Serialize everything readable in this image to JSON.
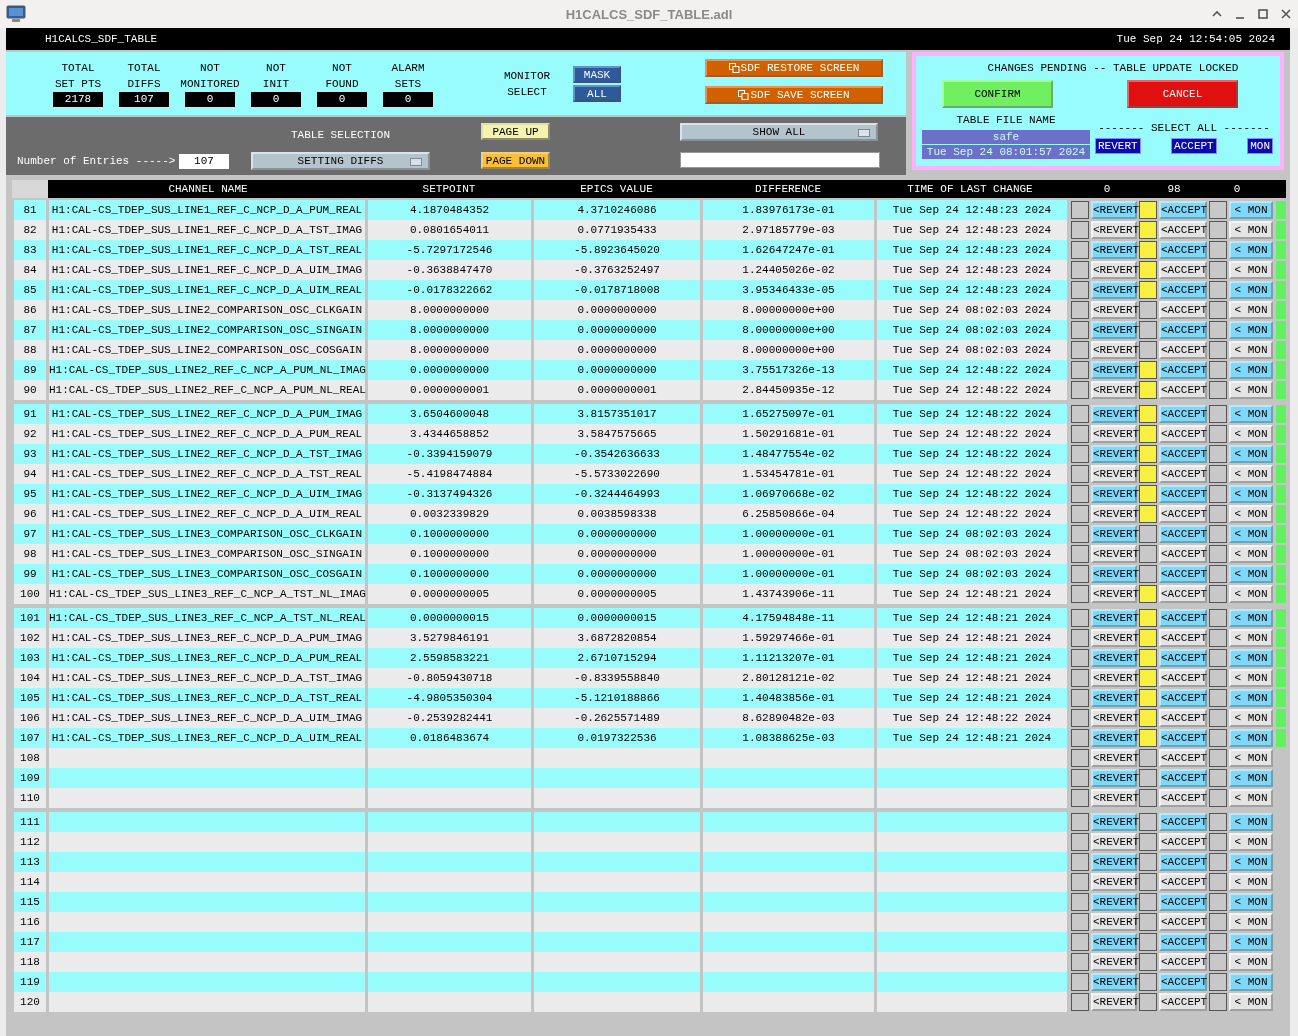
{
  "window": {
    "title": "H1CALCS_SDF_TABLE.adl"
  },
  "header": {
    "screen_name": "H1CALCS_SDF_TABLE",
    "datetime": "Tue Sep 24 12:54:05 2024"
  },
  "stats": [
    {
      "label_lines": [
        "TOTAL",
        "SET PTS"
      ],
      "value": "2178"
    },
    {
      "label_lines": [
        "TOTAL",
        "DIFFS"
      ],
      "value": "107"
    },
    {
      "label_lines": [
        "NOT",
        "MONITORED"
      ],
      "value": "0"
    },
    {
      "label_lines": [
        "NOT",
        "INIT"
      ],
      "value": "0"
    },
    {
      "label_lines": [
        "NOT",
        "FOUND"
      ],
      "value": "0"
    },
    {
      "label_lines": [
        "ALARM",
        "SETS"
      ],
      "value": "0"
    }
  ],
  "monitor_select": {
    "label_lines": [
      "MONITOR",
      "SELECT"
    ],
    "buttons": [
      "MASK",
      "ALL"
    ]
  },
  "screen_buttons": [
    "SDF RESTORE SCREEN",
    "SDF SAVE SCREEN"
  ],
  "table_selection": {
    "label": "TABLE SELECTION",
    "menu": "SETTING DIFFS",
    "entries_label": "Number of Entries ----->",
    "entries_value": "107"
  },
  "page_buttons": [
    {
      "label": "PAGE UP",
      "kind": "up"
    },
    {
      "label": "PAGE DOWN",
      "kind": "down"
    }
  ],
  "filter": {
    "menu": "SHOW ALL"
  },
  "pending_panel": {
    "message": "CHANGES PENDING -- TABLE UPDATE LOCKED",
    "confirm": "CONFIRM",
    "cancel": "CANCEL",
    "file_label": "TABLE FILE NAME",
    "file_name": "safe",
    "file_time": "Tue Sep 24 08:01:57 2024",
    "select_all_label": "------- SELECT ALL -------",
    "select_all_buttons": [
      "REVERT",
      "ACCEPT",
      "MON"
    ]
  },
  "table": {
    "columns": [
      "CHANNEL NAME",
      "SETPOINT",
      "EPICS VALUE",
      "DIFFERENCE",
      "TIME OF LAST CHANGE"
    ],
    "counts": [
      "0",
      "98",
      "0"
    ],
    "groups": [
      {
        "rows": [
          {
            "n": "81",
            "channel": "H1:CAL-CS_TDEP_SUS_LINE1_REF_C_NCP_D_A_PUM_REAL",
            "setpoint": "4.1870484352",
            "epics": "4.3710246086",
            "diff": "1.83976173e-01",
            "time": "Tue Sep 24 12:48:23 2024",
            "revert_checked": false,
            "accept_checked": true,
            "mon_checked": false,
            "status_on": true,
            "buttons": [
              "<REVERT",
              "<ACCEPT",
              "< MON"
            ]
          },
          {
            "n": "82",
            "channel": "H1:CAL-CS_TDEP_SUS_LINE1_REF_C_NCP_D_A_TST_IMAG",
            "setpoint": "0.0801654011",
            "epics": "0.0771935433",
            "diff": "2.97185779e-03",
            "time": "Tue Sep 24 12:48:23 2024",
            "revert_checked": false,
            "accept_checked": true,
            "mon_checked": false,
            "status_on": true,
            "buttons": [
              "<REVERT",
              "<ACCEPT",
              "< MON"
            ]
          },
          {
            "n": "83",
            "channel": "H1:CAL-CS_TDEP_SUS_LINE1_REF_C_NCP_D_A_TST_REAL",
            "setpoint": "-5.7297172546",
            "epics": "-5.8923645020",
            "diff": "1.62647247e-01",
            "time": "Tue Sep 24 12:48:23 2024",
            "revert_checked": false,
            "accept_checked": true,
            "mon_checked": false,
            "status_on": true,
            "buttons": [
              "<REVERT",
              "<ACCEPT",
              "< MON"
            ]
          },
          {
            "n": "84",
            "channel": "H1:CAL-CS_TDEP_SUS_LINE1_REF_C_NCP_D_A_UIM_IMAG",
            "setpoint": "-0.3638847470",
            "epics": "-0.3763252497",
            "diff": "1.24405026e-02",
            "time": "Tue Sep 24 12:48:23 2024",
            "revert_checked": false,
            "accept_checked": true,
            "mon_checked": false,
            "status_on": true,
            "buttons": [
              "<REVERT",
              "<ACCEPT",
              "< MON"
            ]
          },
          {
            "n": "85",
            "channel": "H1:CAL-CS_TDEP_SUS_LINE1_REF_C_NCP_D_A_UIM_REAL",
            "setpoint": "-0.0178322662",
            "epics": "-0.0178718008",
            "diff": "3.95346433e-05",
            "time": "Tue Sep 24 12:48:23 2024",
            "revert_checked": false,
            "accept_checked": true,
            "mon_checked": false,
            "status_on": true,
            "buttons": [
              "<REVERT",
              "<ACCEPT",
              "< MON"
            ]
          },
          {
            "n": "86",
            "channel": "H1:CAL-CS_TDEP_SUS_LINE2_COMPARISON_OSC_CLKGAIN",
            "setpoint": "8.0000000000",
            "epics": "0.0000000000",
            "diff": "8.00000000e+00",
            "time": "Tue Sep 24 08:02:03 2024",
            "revert_checked": false,
            "accept_checked": false,
            "mon_checked": false,
            "status_on": true,
            "buttons": [
              "<REVERT",
              "<ACCEPT",
              "< MON"
            ]
          },
          {
            "n": "87",
            "channel": "H1:CAL-CS_TDEP_SUS_LINE2_COMPARISON_OSC_SINGAIN",
            "setpoint": "8.0000000000",
            "epics": "0.0000000000",
            "diff": "8.00000000e+00",
            "time": "Tue Sep 24 08:02:03 2024",
            "revert_checked": false,
            "accept_checked": false,
            "mon_checked": false,
            "status_on": true,
            "buttons": [
              "<REVERT",
              "<ACCEPT",
              "< MON"
            ]
          },
          {
            "n": "88",
            "channel": "H1:CAL-CS_TDEP_SUS_LINE2_COMPARISON_OSC_COSGAIN",
            "setpoint": "8.0000000000",
            "epics": "0.0000000000",
            "diff": "8.00000000e+00",
            "time": "Tue Sep 24 08:02:03 2024",
            "revert_checked": false,
            "accept_checked": false,
            "mon_checked": false,
            "status_on": true,
            "buttons": [
              "<REVERT",
              "<ACCEPT",
              "< MON"
            ]
          },
          {
            "n": "89",
            "channel": "H1:CAL-CS_TDEP_SUS_LINE2_REF_C_NCP_A_PUM_NL_IMAG",
            "setpoint": "0.0000000000",
            "epics": "0.0000000000",
            "diff": "3.75517326e-13",
            "time": "Tue Sep 24 12:48:22 2024",
            "revert_checked": false,
            "accept_checked": true,
            "mon_checked": false,
            "status_on": true,
            "buttons": [
              "<REVERT",
              "<ACCEPT",
              "< MON"
            ]
          },
          {
            "n": "90",
            "channel": "H1:CAL-CS_TDEP_SUS_LINE2_REF_C_NCP_A_PUM_NL_REAL",
            "setpoint": "0.0000000001",
            "epics": "0.0000000001",
            "diff": "2.84450935e-12",
            "time": "Tue Sep 24 12:48:22 2024",
            "revert_checked": false,
            "accept_checked": true,
            "mon_checked": false,
            "status_on": true,
            "buttons": [
              "<REVERT",
              "<ACCEPT",
              "< MON"
            ]
          }
        ]
      },
      {
        "rows": [
          {
            "n": "91",
            "channel": "H1:CAL-CS_TDEP_SUS_LINE2_REF_C_NCP_D_A_PUM_IMAG",
            "setpoint": "3.6504600048",
            "epics": "3.8157351017",
            "diff": "1.65275097e-01",
            "time": "Tue Sep 24 12:48:22 2024",
            "revert_checked": false,
            "accept_checked": true,
            "mon_checked": false,
            "status_on": true,
            "buttons": [
              "<REVERT",
              "<ACCEPT",
              "< MON"
            ]
          },
          {
            "n": "92",
            "channel": "H1:CAL-CS_TDEP_SUS_LINE2_REF_C_NCP_D_A_PUM_REAL",
            "setpoint": "3.4344658852",
            "epics": "3.5847575665",
            "diff": "1.50291681e-01",
            "time": "Tue Sep 24 12:48:22 2024",
            "revert_checked": false,
            "accept_checked": true,
            "mon_checked": false,
            "status_on": true,
            "buttons": [
              "<REVERT",
              "<ACCEPT",
              "< MON"
            ]
          },
          {
            "n": "93",
            "channel": "H1:CAL-CS_TDEP_SUS_LINE2_REF_C_NCP_D_A_TST_IMAG",
            "setpoint": "-0.3394159079",
            "epics": "-0.3542636633",
            "diff": "1.48477554e-02",
            "time": "Tue Sep 24 12:48:22 2024",
            "revert_checked": false,
            "accept_checked": true,
            "mon_checked": false,
            "status_on": true,
            "buttons": [
              "<REVERT",
              "<ACCEPT",
              "< MON"
            ]
          },
          {
            "n": "94",
            "channel": "H1:CAL-CS_TDEP_SUS_LINE2_REF_C_NCP_D_A_TST_REAL",
            "setpoint": "-5.4198474884",
            "epics": "-5.5733022690",
            "diff": "1.53454781e-01",
            "time": "Tue Sep 24 12:48:22 2024",
            "revert_checked": false,
            "accept_checked": true,
            "mon_checked": false,
            "status_on": true,
            "buttons": [
              "<REVERT",
              "<ACCEPT",
              "< MON"
            ]
          },
          {
            "n": "95",
            "channel": "H1:CAL-CS_TDEP_SUS_LINE2_REF_C_NCP_D_A_UIM_IMAG",
            "setpoint": "-0.3137494326",
            "epics": "-0.3244464993",
            "diff": "1.06970668e-02",
            "time": "Tue Sep 24 12:48:22 2024",
            "revert_checked": false,
            "accept_checked": true,
            "mon_checked": false,
            "status_on": true,
            "buttons": [
              "<REVERT",
              "<ACCEPT",
              "< MON"
            ]
          },
          {
            "n": "96",
            "channel": "H1:CAL-CS_TDEP_SUS_LINE2_REF_C_NCP_D_A_UIM_REAL",
            "setpoint": "0.0032339829",
            "epics": "0.0038598338",
            "diff": "6.25850866e-04",
            "time": "Tue Sep 24 12:48:22 2024",
            "revert_checked": false,
            "accept_checked": true,
            "mon_checked": false,
            "status_on": true,
            "buttons": [
              "<REVERT",
              "<ACCEPT",
              "< MON"
            ]
          },
          {
            "n": "97",
            "channel": "H1:CAL-CS_TDEP_SUS_LINE3_COMPARISON_OSC_CLKGAIN",
            "setpoint": "0.1000000000",
            "epics": "0.0000000000",
            "diff": "1.00000000e-01",
            "time": "Tue Sep 24 08:02:03 2024",
            "revert_checked": false,
            "accept_checked": false,
            "mon_checked": false,
            "status_on": true,
            "buttons": [
              "<REVERT",
              "<ACCEPT",
              "< MON"
            ]
          },
          {
            "n": "98",
            "channel": "H1:CAL-CS_TDEP_SUS_LINE3_COMPARISON_OSC_SINGAIN",
            "setpoint": "0.1000000000",
            "epics": "0.0000000000",
            "diff": "1.00000000e-01",
            "time": "Tue Sep 24 08:02:03 2024",
            "revert_checked": false,
            "accept_checked": false,
            "mon_checked": false,
            "status_on": true,
            "buttons": [
              "<REVERT",
              "<ACCEPT",
              "< MON"
            ]
          },
          {
            "n": "99",
            "channel": "H1:CAL-CS_TDEP_SUS_LINE3_COMPARISON_OSC_COSGAIN",
            "setpoint": "0.1000000000",
            "epics": "0.0000000000",
            "diff": "1.00000000e-01",
            "time": "Tue Sep 24 08:02:03 2024",
            "revert_checked": false,
            "accept_checked": false,
            "mon_checked": false,
            "status_on": true,
            "buttons": [
              "<REVERT",
              "<ACCEPT",
              "< MON"
            ]
          },
          {
            "n": "100",
            "channel": "H1:CAL-CS_TDEP_SUS_LINE3_REF_C_NCP_A_TST_NL_IMAG",
            "setpoint": "0.0000000005",
            "epics": "0.0000000005",
            "diff": "1.43743906e-11",
            "time": "Tue Sep 24 12:48:21 2024",
            "revert_checked": false,
            "accept_checked": true,
            "mon_checked": false,
            "status_on": true,
            "buttons": [
              "<REVERT",
              "<ACCEPT",
              "< MON"
            ]
          }
        ]
      },
      {
        "rows": [
          {
            "n": "101",
            "channel": "H1:CAL-CS_TDEP_SUS_LINE3_REF_C_NCP_A_TST_NL_REAL",
            "setpoint": "0.0000000015",
            "epics": "0.0000000015",
            "diff": "4.17594848e-11",
            "time": "Tue Sep 24 12:48:21 2024",
            "revert_checked": false,
            "accept_checked": true,
            "mon_checked": false,
            "status_on": true,
            "buttons": [
              "<REVERT",
              "<ACCEPT",
              "< MON"
            ]
          },
          {
            "n": "102",
            "channel": "H1:CAL-CS_TDEP_SUS_LINE3_REF_C_NCP_D_A_PUM_IMAG",
            "setpoint": "3.5279846191",
            "epics": "3.6872820854",
            "diff": "1.59297466e-01",
            "time": "Tue Sep 24 12:48:21 2024",
            "revert_checked": false,
            "accept_checked": true,
            "mon_checked": false,
            "status_on": true,
            "buttons": [
              "<REVERT",
              "<ACCEPT",
              "< MON"
            ]
          },
          {
            "n": "103",
            "channel": "H1:CAL-CS_TDEP_SUS_LINE3_REF_C_NCP_D_A_PUM_REAL",
            "setpoint": "2.5598583221",
            "epics": "2.6710715294",
            "diff": "1.11213207e-01",
            "time": "Tue Sep 24 12:48:21 2024",
            "revert_checked": false,
            "accept_checked": true,
            "mon_checked": false,
            "status_on": true,
            "buttons": [
              "<REVERT",
              "<ACCEPT",
              "< MON"
            ]
          },
          {
            "n": "104",
            "channel": "H1:CAL-CS_TDEP_SUS_LINE3_REF_C_NCP_D_A_TST_IMAG",
            "setpoint": "-0.8059430718",
            "epics": "-0.8339558840",
            "diff": "2.80128121e-02",
            "time": "Tue Sep 24 12:48:21 2024",
            "revert_checked": false,
            "accept_checked": true,
            "mon_checked": false,
            "status_on": true,
            "buttons": [
              "<REVERT",
              "<ACCEPT",
              "< MON"
            ]
          },
          {
            "n": "105",
            "channel": "H1:CAL-CS_TDEP_SUS_LINE3_REF_C_NCP_D_A_TST_REAL",
            "setpoint": "-4.9805350304",
            "epics": "-5.1210188866",
            "diff": "1.40483856e-01",
            "time": "Tue Sep 24 12:48:21 2024",
            "revert_checked": false,
            "accept_checked": true,
            "mon_checked": false,
            "status_on": true,
            "buttons": [
              "<REVERT",
              "<ACCEPT",
              "< MON"
            ]
          },
          {
            "n": "106",
            "channel": "H1:CAL-CS_TDEP_SUS_LINE3_REF_C_NCP_D_A_UIM_IMAG",
            "setpoint": "-0.2539282441",
            "epics": "-0.2625571489",
            "diff": "8.62890482e-03",
            "time": "Tue Sep 24 12:48:22 2024",
            "revert_checked": false,
            "accept_checked": true,
            "mon_checked": false,
            "status_on": true,
            "buttons": [
              "<REVERT",
              "<ACCEPT",
              "< MON"
            ]
          },
          {
            "n": "107",
            "channel": "H1:CAL-CS_TDEP_SUS_LINE3_REF_C_NCP_D_A_UIM_REAL",
            "setpoint": "0.0186483674",
            "epics": "0.0197322536",
            "diff": "1.08388625e-03",
            "time": "Tue Sep 24 12:48:21 2024",
            "revert_checked": false,
            "accept_checked": true,
            "mon_checked": false,
            "status_on": true,
            "buttons": [
              "<REVERT",
              "<ACCEPT",
              "< MON"
            ]
          },
          {
            "n": "108",
            "revert_checked": false,
            "accept_checked": false,
            "mon_checked": false,
            "status_on": false,
            "buttons": [
              "<REVERT",
              "<ACCEPT",
              "< MON"
            ]
          },
          {
            "n": "109",
            "revert_checked": false,
            "accept_checked": false,
            "mon_checked": false,
            "status_on": false,
            "buttons": [
              "<REVERT",
              "<ACCEPT",
              "< MON"
            ]
          },
          {
            "n": "110",
            "revert_checked": false,
            "accept_checked": false,
            "mon_checked": false,
            "status_on": false,
            "buttons": [
              "<REVERT",
              "<ACCEPT",
              "< MON"
            ]
          }
        ]
      },
      {
        "rows": [
          {
            "n": "111",
            "revert_checked": false,
            "accept_checked": false,
            "mon_checked": false,
            "status_on": false,
            "buttons": [
              "<REVERT",
              "<ACCEPT",
              "< MON"
            ]
          },
          {
            "n": "112",
            "revert_checked": false,
            "accept_checked": false,
            "mon_checked": false,
            "status_on": false,
            "buttons": [
              "<REVERT",
              "<ACCEPT",
              "< MON"
            ]
          },
          {
            "n": "113",
            "revert_checked": false,
            "accept_checked": false,
            "mon_checked": false,
            "status_on": false,
            "buttons": [
              "<REVERT",
              "<ACCEPT",
              "< MON"
            ]
          },
          {
            "n": "114",
            "revert_checked": false,
            "accept_checked": false,
            "mon_checked": false,
            "status_on": false,
            "buttons": [
              "<REVERT",
              "<ACCEPT",
              "< MON"
            ]
          },
          {
            "n": "115",
            "revert_checked": false,
            "accept_checked": false,
            "mon_checked": false,
            "status_on": false,
            "buttons": [
              "<REVERT",
              "<ACCEPT",
              "< MON"
            ]
          },
          {
            "n": "116",
            "revert_checked": false,
            "accept_checked": false,
            "mon_checked": false,
            "status_on": false,
            "buttons": [
              "<REVERT",
              "<ACCEPT",
              "< MON"
            ]
          },
          {
            "n": "117",
            "revert_checked": false,
            "accept_checked": false,
            "mon_checked": false,
            "status_on": false,
            "buttons": [
              "<REVERT",
              "<ACCEPT",
              "< MON"
            ]
          },
          {
            "n": "118",
            "revert_checked": false,
            "accept_checked": false,
            "mon_checked": false,
            "status_on": false,
            "buttons": [
              "<REVERT",
              "<ACCEPT",
              "< MON"
            ]
          },
          {
            "n": "119",
            "revert_checked": false,
            "accept_checked": false,
            "mon_checked": false,
            "status_on": false,
            "buttons": [
              "<REVERT",
              "<ACCEPT",
              "< MON"
            ]
          },
          {
            "n": "120",
            "revert_checked": false,
            "accept_checked": false,
            "mon_checked": false,
            "status_on": false,
            "buttons": [
              "<REVERT",
              "<ACCEPT",
              "< MON"
            ]
          }
        ]
      }
    ]
  }
}
